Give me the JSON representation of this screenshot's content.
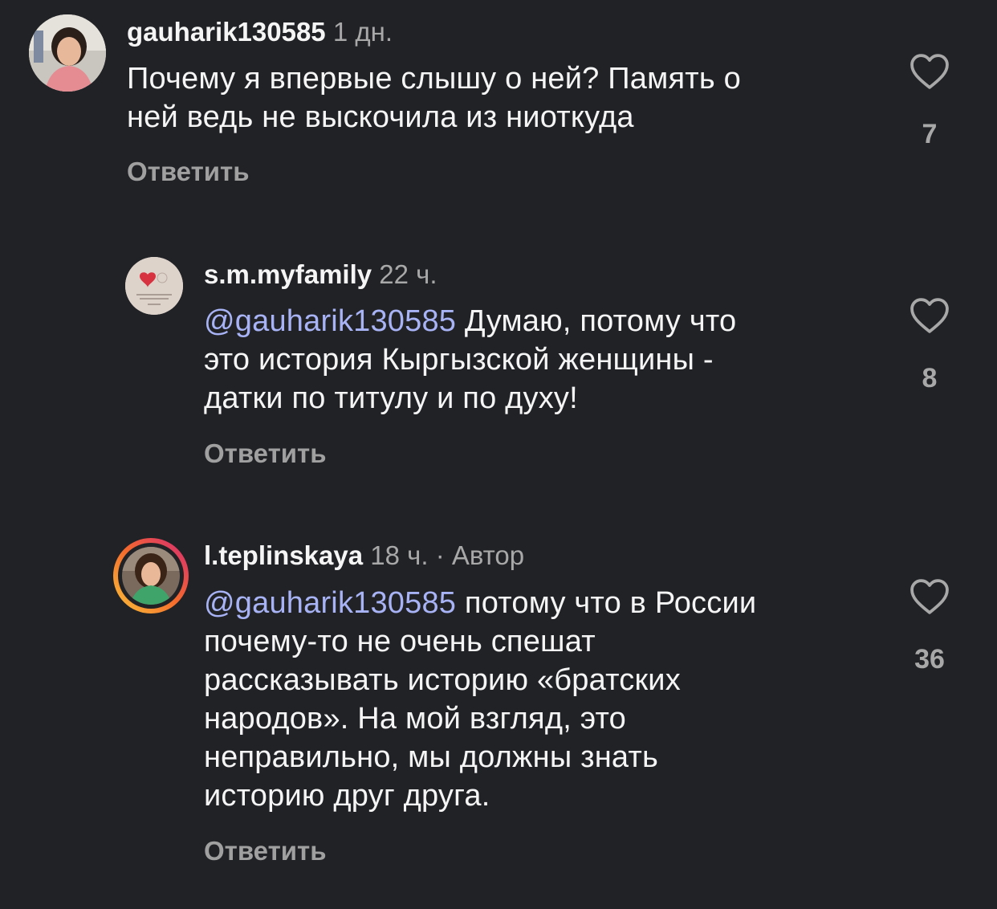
{
  "comments": [
    {
      "username": "gauharik130585",
      "time": "1 дн.",
      "author_tag": "",
      "mention": "",
      "text": "Почему я впервые слышу о ней? Память о ней ведь не выскочила из ниоткуда",
      "text_lines": [
        "Почему я впервые слышу о ней? Память о",
        "ней ведь не выскочила из ниоткуда"
      ],
      "likes": "7",
      "reply_label": "Ответить"
    },
    {
      "username": "s.m.myfamily",
      "time": "22 ч.",
      "author_tag": "",
      "mention": "@gauharik130585",
      "text_lines": [
        "Думаю, потому что",
        "это история Кыргызской женщины -",
        "датки по титулу и по духу!"
      ],
      "likes": "8",
      "reply_label": "Ответить"
    },
    {
      "username": "l.teplinskaya",
      "time": "18 ч.",
      "author_tag": "· Автор",
      "mention": "@gauharik130585",
      "text_lines": [
        "потому что в России",
        "почему-то не очень спешат",
        "рассказывать историю «братских",
        "народов». На мой взгляд, это",
        "неправильно, мы должны знать",
        "историю друг друга."
      ],
      "likes": "36",
      "reply_label": "Ответить"
    }
  ],
  "colors": {
    "background": "#212226",
    "mention": "#a8b3f5",
    "story_ring_start": "#f9c33a",
    "story_ring_end": "#d62976"
  },
  "icons": [
    "heart-icon"
  ]
}
